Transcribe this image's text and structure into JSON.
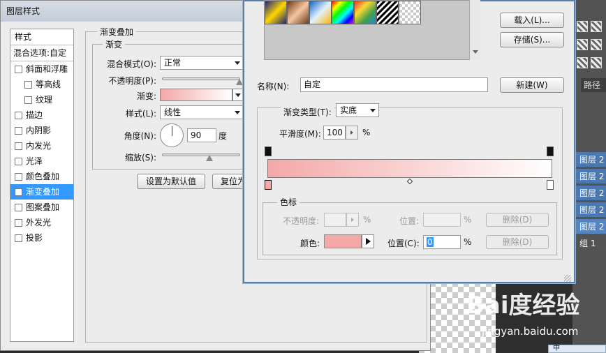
{
  "layer_style_dialog": {
    "title": "图层样式",
    "styles_header": "样式",
    "blend_options": "混合选项:自定",
    "style_items": [
      {
        "label": "斜面和浮雕",
        "checked": false,
        "indent": false
      },
      {
        "label": "等高线",
        "checked": false,
        "indent": true
      },
      {
        "label": "纹理",
        "checked": false,
        "indent": true
      },
      {
        "label": "描边",
        "checked": false,
        "indent": false
      },
      {
        "label": "内阴影",
        "checked": false,
        "indent": false
      },
      {
        "label": "内发光",
        "checked": false,
        "indent": false
      },
      {
        "label": "光泽",
        "checked": false,
        "indent": false
      },
      {
        "label": "颜色叠加",
        "checked": false,
        "indent": false
      },
      {
        "label": "渐变叠加",
        "checked": true,
        "indent": false,
        "selected": true
      },
      {
        "label": "图案叠加",
        "checked": false,
        "indent": false
      },
      {
        "label": "外发光",
        "checked": false,
        "indent": false
      },
      {
        "label": "投影",
        "checked": false,
        "indent": false
      }
    ],
    "section_title": "渐变叠加",
    "subsection_title": "渐变",
    "blend_mode_label": "混合模式(O):",
    "blend_mode_value": "正常",
    "opacity_label": "不透明度(P):",
    "gradient_label": "渐变:",
    "style_label": "样式(L):",
    "style_value": "线性",
    "angle_label": "角度(N):",
    "angle_value": "90",
    "angle_unit": "度",
    "scale_label": "缩放(S):",
    "set_default_button": "设置为默认值",
    "reset_button": "复位为"
  },
  "gradient_editor": {
    "load_button": "载入(L)...",
    "save_button": "存储(S)...",
    "name_label": "名称(N):",
    "name_value": "自定",
    "new_button": "新建(W)",
    "gradient_type_label": "渐变类型(T):",
    "gradient_type_value": "实底",
    "smoothness_label": "平滑度(M):",
    "smoothness_value": "100",
    "smoothness_unit": "%",
    "stops_title": "色标",
    "stop_opacity_label": "不透明度:",
    "stop_opacity_unit": "%",
    "stop_position_label": "位置:",
    "stop_position_unit": "%",
    "delete_button": "删除(D)",
    "color_label": "颜色:",
    "color_position_label": "位置(C):",
    "color_position_value": "0",
    "color_position_unit": "%",
    "color_delete_button": "删除(D)",
    "stop_color": "#f4a8a8"
  },
  "photoshop_panel": {
    "path_tab": "路径",
    "layers": [
      "图层 2",
      "图层 2",
      "图层 2",
      "图层 2",
      "图层 2",
      "组 1"
    ]
  },
  "watermark": {
    "logo": "Bai度经验",
    "url": "jingyan.baidu.com"
  },
  "taskbar": {
    "chip_text": "中"
  }
}
